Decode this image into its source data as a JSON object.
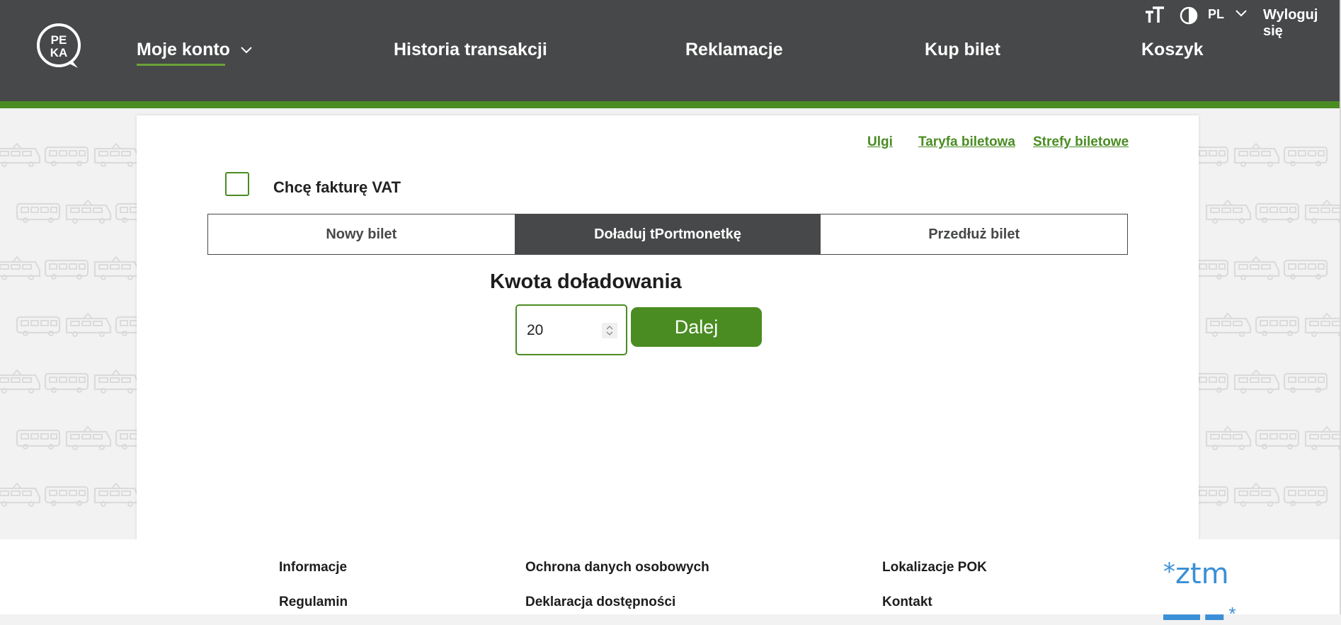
{
  "header": {
    "logo_text": "PEKA",
    "nav": [
      {
        "label": "Moje konto"
      },
      {
        "label": "Historia transakcji"
      },
      {
        "label": "Reklamacje"
      },
      {
        "label": "Kup bilet"
      },
      {
        "label": "Koszyk"
      }
    ],
    "language": "PL",
    "logout_label": "Wyloguj się"
  },
  "top_links": {
    "ulgi": "Ulgi",
    "taryfa": "Taryfa biletowa",
    "strefy": "Strefy biletowe"
  },
  "vat": {
    "label": "Chcę fakturę VAT",
    "checked": false
  },
  "tabs": [
    {
      "label": "Nowy bilet",
      "active": false
    },
    {
      "label": "Doładuj tPortmonetkę",
      "active": true
    },
    {
      "label": "Przedłuż bilet",
      "active": false
    }
  ],
  "topup": {
    "title": "Kwota doładowania",
    "amount": "20",
    "submit_label": "Dalej"
  },
  "footer": {
    "col1": [
      "Informacje",
      "Regulamin"
    ],
    "col2": [
      "Ochrona danych osobowych",
      "Deklaracja dostępności"
    ],
    "col3": [
      "Lokalizacje POK",
      "Kontakt"
    ],
    "logo_text": "ztm"
  },
  "colors": {
    "header_bg": "#474849",
    "accent_green": "#4a8c22",
    "logo_blue": "#3a8fd6"
  },
  "icons": {
    "text_size": "text-size-icon",
    "contrast": "contrast-icon",
    "chevron": "chevron-down-icon",
    "background": "tram-bus-pattern-icon"
  }
}
